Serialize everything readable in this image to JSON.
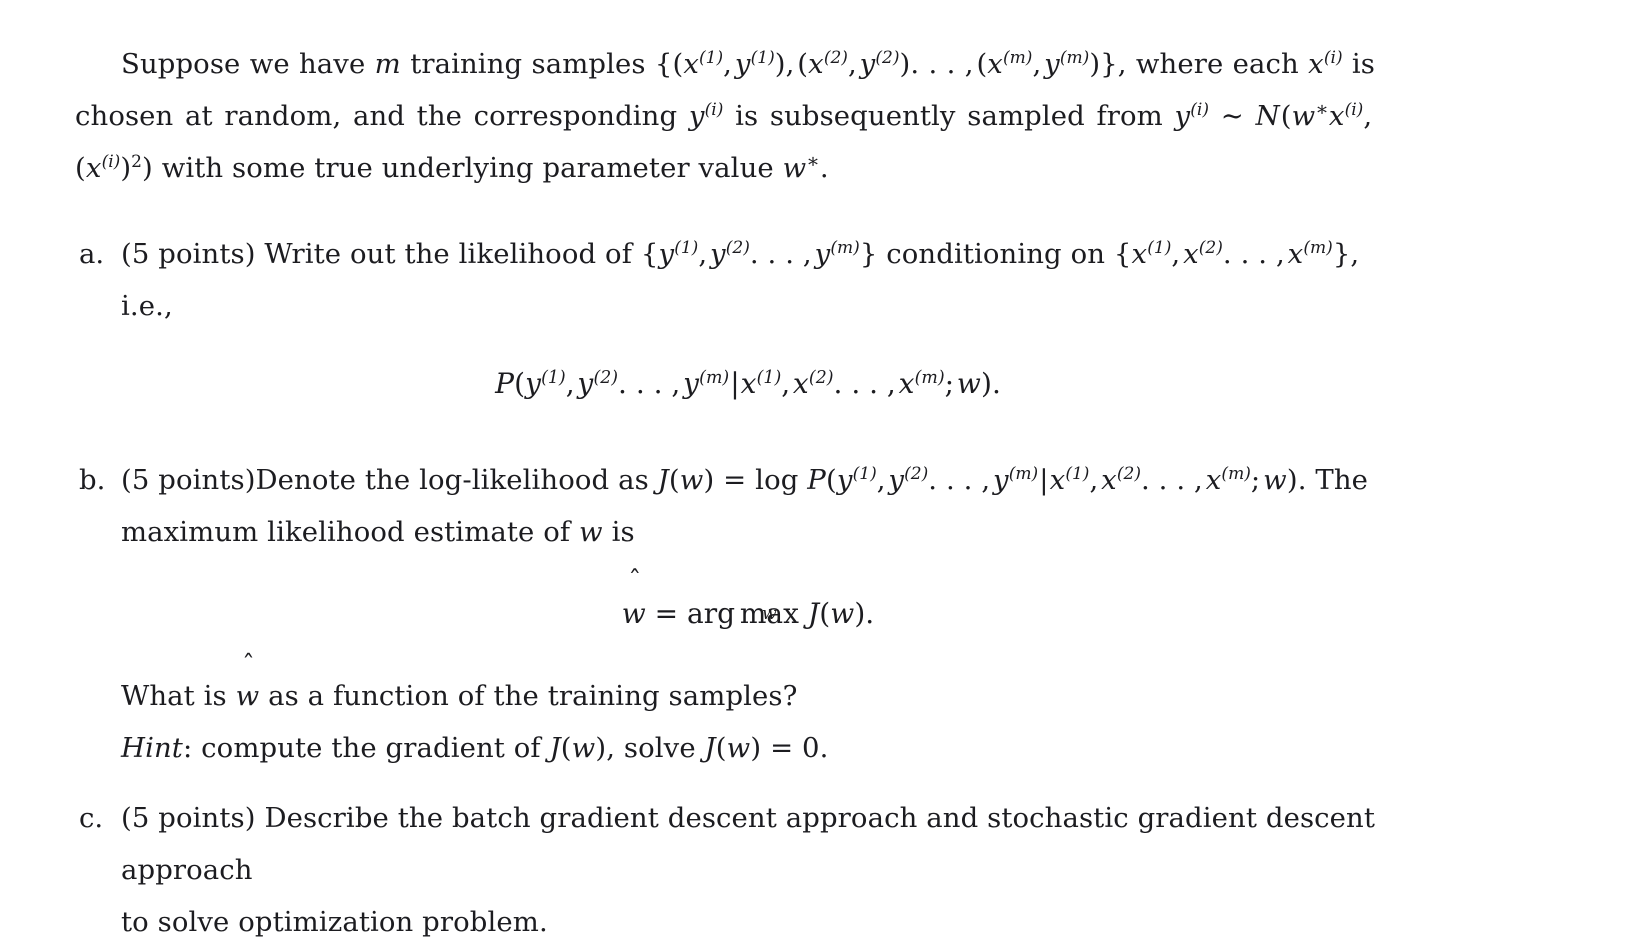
{
  "document": {
    "intro": {
      "text_plain": "Suppose we have m training samples {(x(1), y(1)), (x(2), y(2)), . . . , (x(m), y(m))}, where each x(i) is chosen at random, and the corresponding y(i) is subsequently sampled from y(i) ~ N(w*x(i), (x(i))^2) with some true underlying parameter value w*.",
      "segments": {
        "s1": "Suppose we have",
        "m": "m",
        "s2": "training samples",
        "brace_open": "{(",
        "x": "x",
        "y": "y",
        "exp1": "(1)",
        "exp2": "(2)",
        "expm": "(m)",
        "expi": "(i)",
        "s3": "where each",
        "s4": "is",
        "s5": "chosen at random, and the corresponding",
        "s6": "is subsequently sampled from",
        "sim": "∼",
        "cal_n": "N",
        "w": "w",
        "star": "∗",
        "s7": "with some true underlying parameter value",
        "period": "."
      }
    },
    "items": [
      {
        "label": "a.",
        "points": "(5 points)",
        "text": "Write out the likelihood of {y(1), y(2), . . . , y(m)} conditioning on {x(1), x(2), . . . , x(m)},",
        "lead": "Write out the likelihood of",
        "mid": "conditioning on",
        "ie": "i.e.,",
        "equation_plain": "P(y(1), y(2), . . . , y(m) | x(1), x(2), . . . , x(m); w)."
      },
      {
        "label": "b.",
        "points": "(5 points)",
        "text": "Denote the log-likelihood as J(w) = log P(y(1), y(2), . . . , y(m)|x(1), x(2), . . . , x(m); w). The maximum likelihood estimate of w is",
        "lead": "Denote the log-likelihood as",
        "tail": "The",
        "line2": "maximum likelihood estimate of",
        "line2_tail": "is",
        "equation_plain": "ŵ = arg max_w J(w).",
        "question": "What is ŵ as a function of the training samples?",
        "question_lead": "What is",
        "question_tail": "as a function of the training samples?",
        "hint_label": "Hint",
        "hint_text": ": compute the gradient of J(w), solve J(w) = 0.",
        "hint_seg1": ": compute the gradient of",
        "hint_seg2": ", solve",
        "hint_seg3": "= 0."
      },
      {
        "label": "c.",
        "points": "(5 points)",
        "text": "Describe the batch gradient descent approach and stochastic gradient descent approach to solve optimization problem.",
        "line1": "Describe the batch gradient descent approach and stochastic gradient descent approach",
        "line2": "to solve optimization problem."
      }
    ],
    "symbols": {
      "J": "J",
      "P": "P",
      "w": "w",
      "x": "x",
      "y": "y",
      "m": "m",
      "log": "log",
      "arg": "arg",
      "max": "max",
      "equals": "=",
      "zero": "0",
      "comma": ",",
      "dots": ". . . ,",
      "semicolon": ";",
      "paren_open": "(",
      "paren_close": ")",
      "brace_open": "{",
      "brace_close": "}",
      "bar": "|",
      "period": ".",
      "sub_w": "w"
    },
    "colors": {
      "background": "#ffffff",
      "text": "#1c1c20"
    }
  }
}
